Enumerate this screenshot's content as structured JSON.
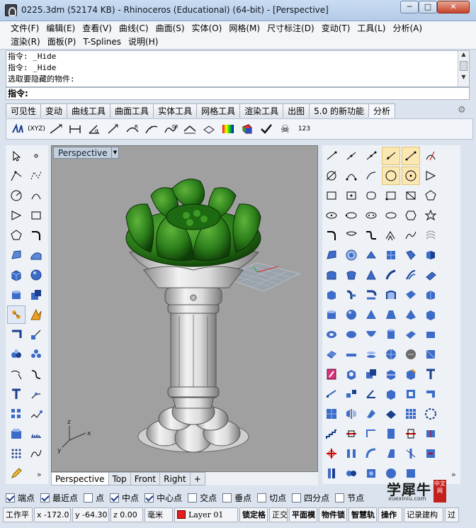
{
  "window": {
    "title": "0225.3dm (52174 KB) - Rhinoceros (Educational) (64-bit) - [Perspective]",
    "min_glyph": "─",
    "max_glyph": "□",
    "close_glyph": "✕"
  },
  "menu": {
    "row1": [
      "文件(F)",
      "编辑(E)",
      "查看(V)",
      "曲线(C)",
      "曲面(S)",
      "实体(O)",
      "网格(M)",
      "尺寸标注(D)",
      "变动(T)",
      "工具(L)",
      "分析(A)"
    ],
    "row2": [
      "渲染(R)",
      "面板(P)",
      "T-Splines",
      "说明(H)"
    ]
  },
  "command": {
    "history": [
      "指令: _Hide",
      "指令: _Hide",
      "选取要隐藏的物件:"
    ],
    "prompt": "指令:"
  },
  "tabs": [
    "可见性",
    "变动",
    "曲线工具",
    "曲面工具",
    "实体工具",
    "网格工具",
    "渲染工具",
    "出图",
    "5.0 的新功能",
    "分析"
  ],
  "active_tab": "分析",
  "toolbar": {
    "xyz_label": "(XYZ)",
    "num_label": "123"
  },
  "viewport": {
    "name": "Perspective",
    "axis_x": "x",
    "axis_y": "y",
    "axis_z": "z",
    "model_colors": {
      "flower": "#2b7d1a",
      "base": "#dcdcdc",
      "background": "#a0a0a0"
    }
  },
  "viewport_tabs": [
    "Perspective",
    "Top",
    "Front",
    "Right"
  ],
  "viewport_tab_add": "+",
  "osnap": [
    {
      "label": "端点",
      "checked": true
    },
    {
      "label": "最近点",
      "checked": true
    },
    {
      "label": "点",
      "checked": false
    },
    {
      "label": "中点",
      "checked": true
    },
    {
      "label": "中心点",
      "checked": true
    },
    {
      "label": "交点",
      "checked": false
    },
    {
      "label": "垂点",
      "checked": false
    },
    {
      "label": "切点",
      "checked": false
    },
    {
      "label": "四分点",
      "checked": false
    },
    {
      "label": "节点",
      "checked": false
    }
  ],
  "status": {
    "cplane": "工作平",
    "x": "x -172.0",
    "y": "y -64.30",
    "z": "z 0.00",
    "units": "毫米",
    "layer": "Layer 01",
    "layer_color": "#e51c1c",
    "grid_snap": "锁定格",
    "ortho": "正交",
    "planar": "平面模",
    "osnap": "物件锁",
    "smarttrack": "智慧轨",
    "gumball": "操作",
    "history": "记录建构",
    "filter": "过"
  },
  "watermark": {
    "main": "学犀牛",
    "sub": "xuexiniu.com",
    "badge": "中文网"
  }
}
